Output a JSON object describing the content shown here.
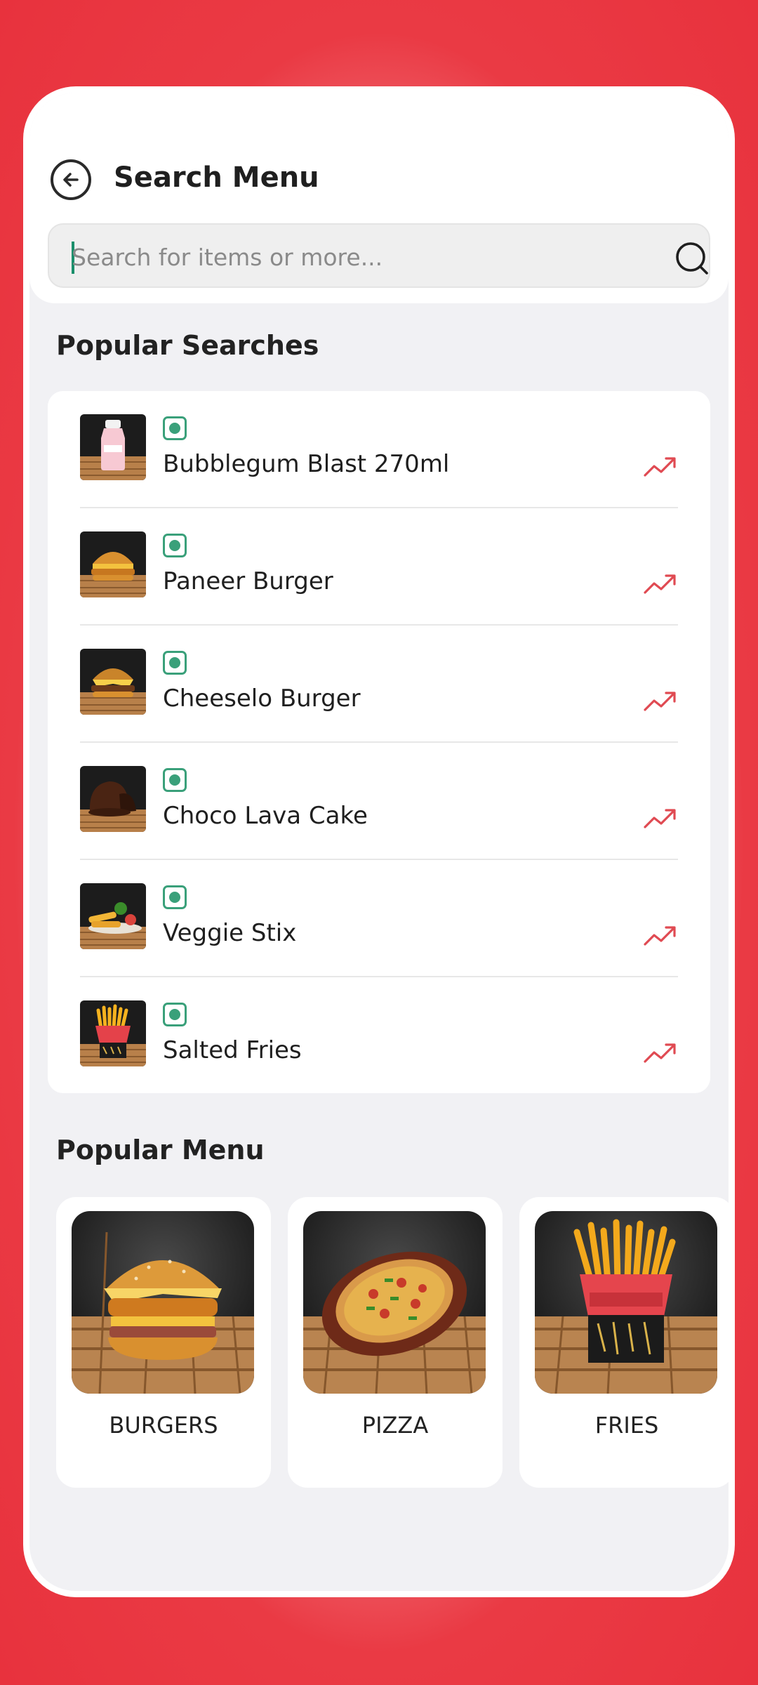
{
  "header": {
    "title": "Search Menu"
  },
  "search": {
    "placeholder": "Search for items or more...",
    "value": ""
  },
  "popular_searches": {
    "title": "Popular Searches",
    "items": [
      {
        "label": "Bubblegum Blast 270ml",
        "icon": "milk-bottle-image"
      },
      {
        "label": "Paneer Burger",
        "icon": "burger-image"
      },
      {
        "label": "Cheeselo Burger",
        "icon": "burger-image"
      },
      {
        "label": "Choco Lava Cake",
        "icon": "lava-cake-image"
      },
      {
        "label": "Veggie Stix",
        "icon": "veggie-stix-image"
      },
      {
        "label": "Salted Fries",
        "icon": "fries-image"
      }
    ]
  },
  "popular_menu": {
    "title": "Popular Menu",
    "items": [
      {
        "label": "BURGERS",
        "icon": "burger-image"
      },
      {
        "label": "PIZZA",
        "icon": "pizza-image"
      },
      {
        "label": "FRIES",
        "icon": "fries-image"
      }
    ]
  },
  "colors": {
    "accent_red": "#e8323d",
    "veg_green": "#3aa07a",
    "trend_red": "#e04a52",
    "caret": "#1a8f6b"
  }
}
